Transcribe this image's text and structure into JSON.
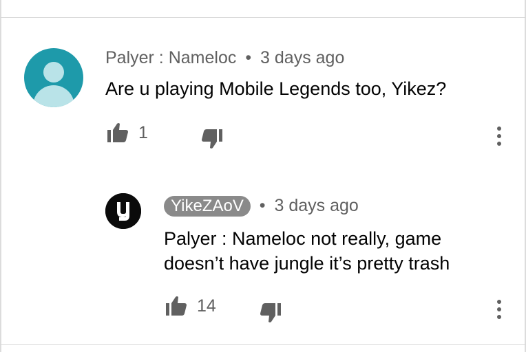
{
  "comments": [
    {
      "author": "Palyer : Nameloc",
      "time": "3 days ago",
      "text": "Are u playing Mobile Legends too, Yikez?",
      "likes": "1"
    }
  ],
  "reply": {
    "author": "YikeZAoV",
    "time": "3 days ago",
    "text_line1": "Palyer : Nameloc not really, game",
    "text_line2": "doesn’t have jungle it’s pretty trash",
    "likes": "14"
  },
  "separator": "•",
  "icons": {
    "like": "thumbs-up-icon",
    "dislike": "thumbs-down-icon",
    "more": "more-vert-icon",
    "avatar_default": "default-user-avatar",
    "avatar_reply": "y-logo-avatar"
  },
  "colors": {
    "avatar_bg": "#1e9aaa",
    "chip_bg": "#8a8a8a",
    "meta_text": "#606060"
  }
}
